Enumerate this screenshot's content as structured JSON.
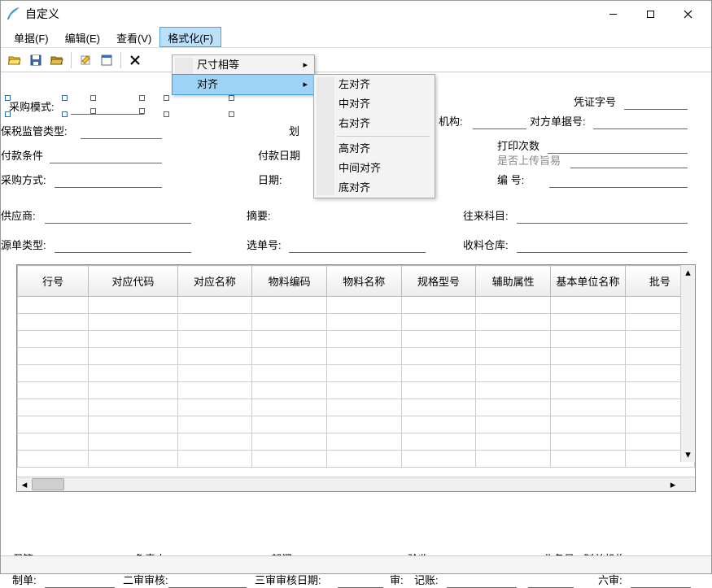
{
  "window": {
    "title": "自定义"
  },
  "menubar": {
    "items": [
      {
        "label": "单据(F)"
      },
      {
        "label": "编辑(E)"
      },
      {
        "label": "查看(V)"
      },
      {
        "label": "格式化(F)"
      }
    ]
  },
  "menu1": {
    "items": [
      {
        "label": "尺寸相等"
      },
      {
        "label": "对齐"
      }
    ]
  },
  "menu2": {
    "sep_after": 2,
    "items": [
      {
        "label": "左对齐"
      },
      {
        "label": "中对齐"
      },
      {
        "label": "右对齐"
      },
      {
        "label": "高对齐"
      },
      {
        "label": "中间对齐"
      },
      {
        "label": "底对齐"
      }
    ]
  },
  "form": {
    "r1": {
      "c1": "采购模式:",
      "c2": "凭证字号"
    },
    "r2": {
      "c1": "保税监管类型:",
      "c2": "机构:",
      "c3": "对方单据号:"
    },
    "r3": {
      "c1": "付款条件",
      "c2": "付款日期",
      "c3a": "打印次数",
      "c3b": "是否上传旨易"
    },
    "r4": {
      "c1": "采购方式:",
      "c2": "日期:",
      "c3": "编    号:"
    },
    "r5": {
      "c1": "供应商:",
      "c2": "摘要:",
      "c3": "往来科目:"
    },
    "r6": {
      "c1": "源单类型:",
      "c2": "选单号:",
      "c3": "收料仓库:"
    },
    "partial_label": "划"
  },
  "table": {
    "headers": [
      "行号",
      "对应代码",
      "对应名称",
      "物料编码",
      "物料名称",
      "规格型号",
      "辅助属性",
      "基本单位名称",
      "批号"
    ]
  },
  "footer": {
    "row1": {
      "a": "保管:",
      "b": "负责人:",
      "c": "部门:",
      "d": "验收:",
      "e": "业务员:",
      "f": "制单机构:"
    },
    "row2": {
      "a": "制单:",
      "b": "二审审核:",
      "c": "三审审核日期:",
      "d": "审:",
      "e": "记账:",
      "f": "六审:"
    }
  }
}
